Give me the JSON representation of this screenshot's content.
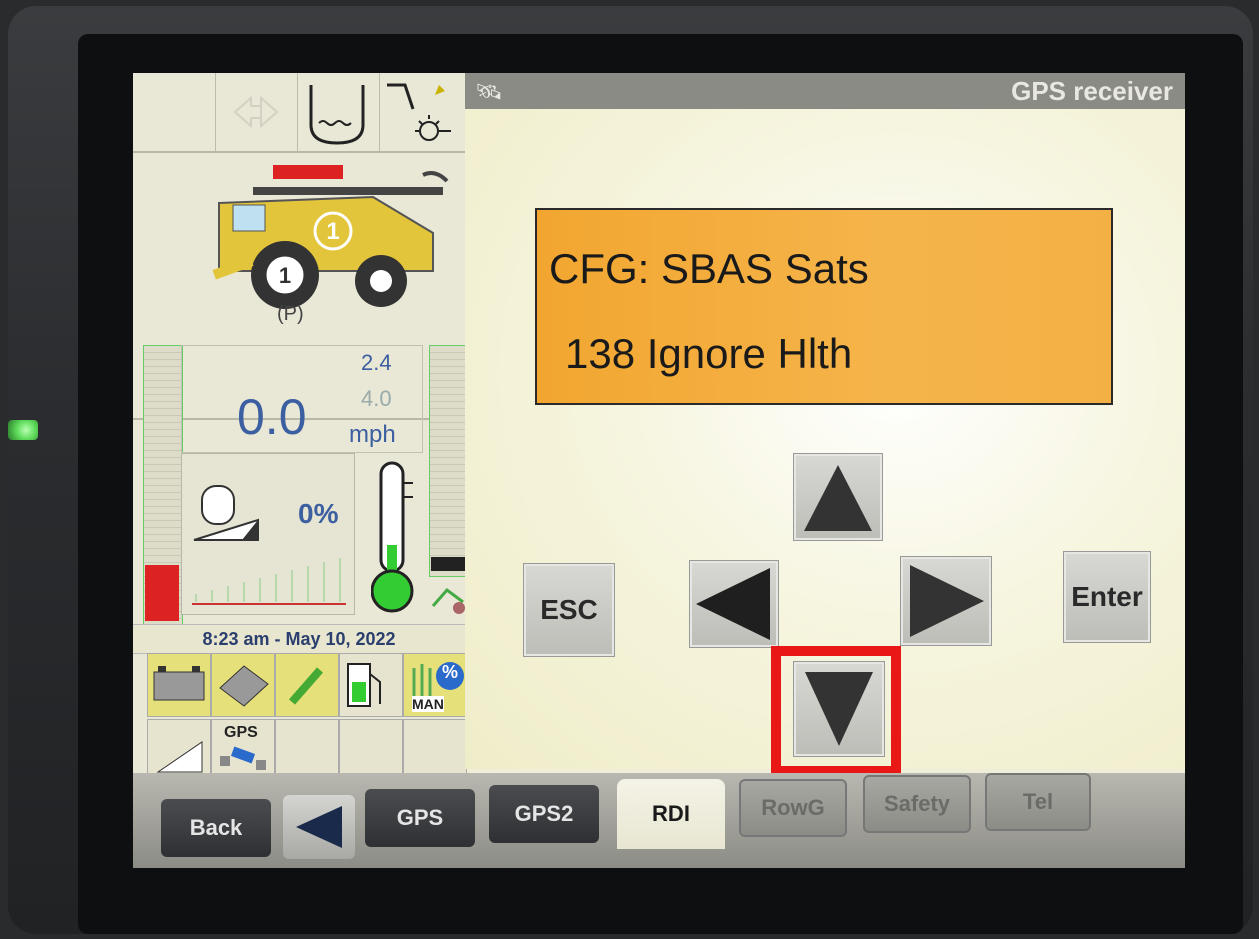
{
  "header": {
    "title": "GPS receiver",
    "icon": "satellite-icon"
  },
  "display": {
    "line1": "CFG: SBAS Sats",
    "line2": "138 Ignore Hlth"
  },
  "gauges": {
    "ground_speed": "0.0",
    "speed_target": "2.4",
    "speed_secondary": "4.0",
    "speed_unit": "mph",
    "engine_load": "0%"
  },
  "datetime": "8:23 am - May 10, 2022",
  "machine": {
    "header_number": "1",
    "park_indicator": "(P)"
  },
  "status_icons": {
    "gps_label": "GPS",
    "man_label": "MAN",
    "percent_label": "%"
  },
  "buttons": {
    "esc": "ESC",
    "enter": "Enter"
  },
  "tabs": [
    {
      "label": "Back"
    },
    {
      "label": "GPS"
    },
    {
      "label": "GPS2"
    },
    {
      "label": "RDI",
      "active": true
    },
    {
      "label": "RowG",
      "disabled": true
    },
    {
      "label": "Safety",
      "disabled": true
    },
    {
      "label": "Tel",
      "disabled": true
    }
  ],
  "colors": {
    "display_bg": "#F2A630",
    "highlight": "#EA1717",
    "text_blue": "#3B5FA0"
  }
}
